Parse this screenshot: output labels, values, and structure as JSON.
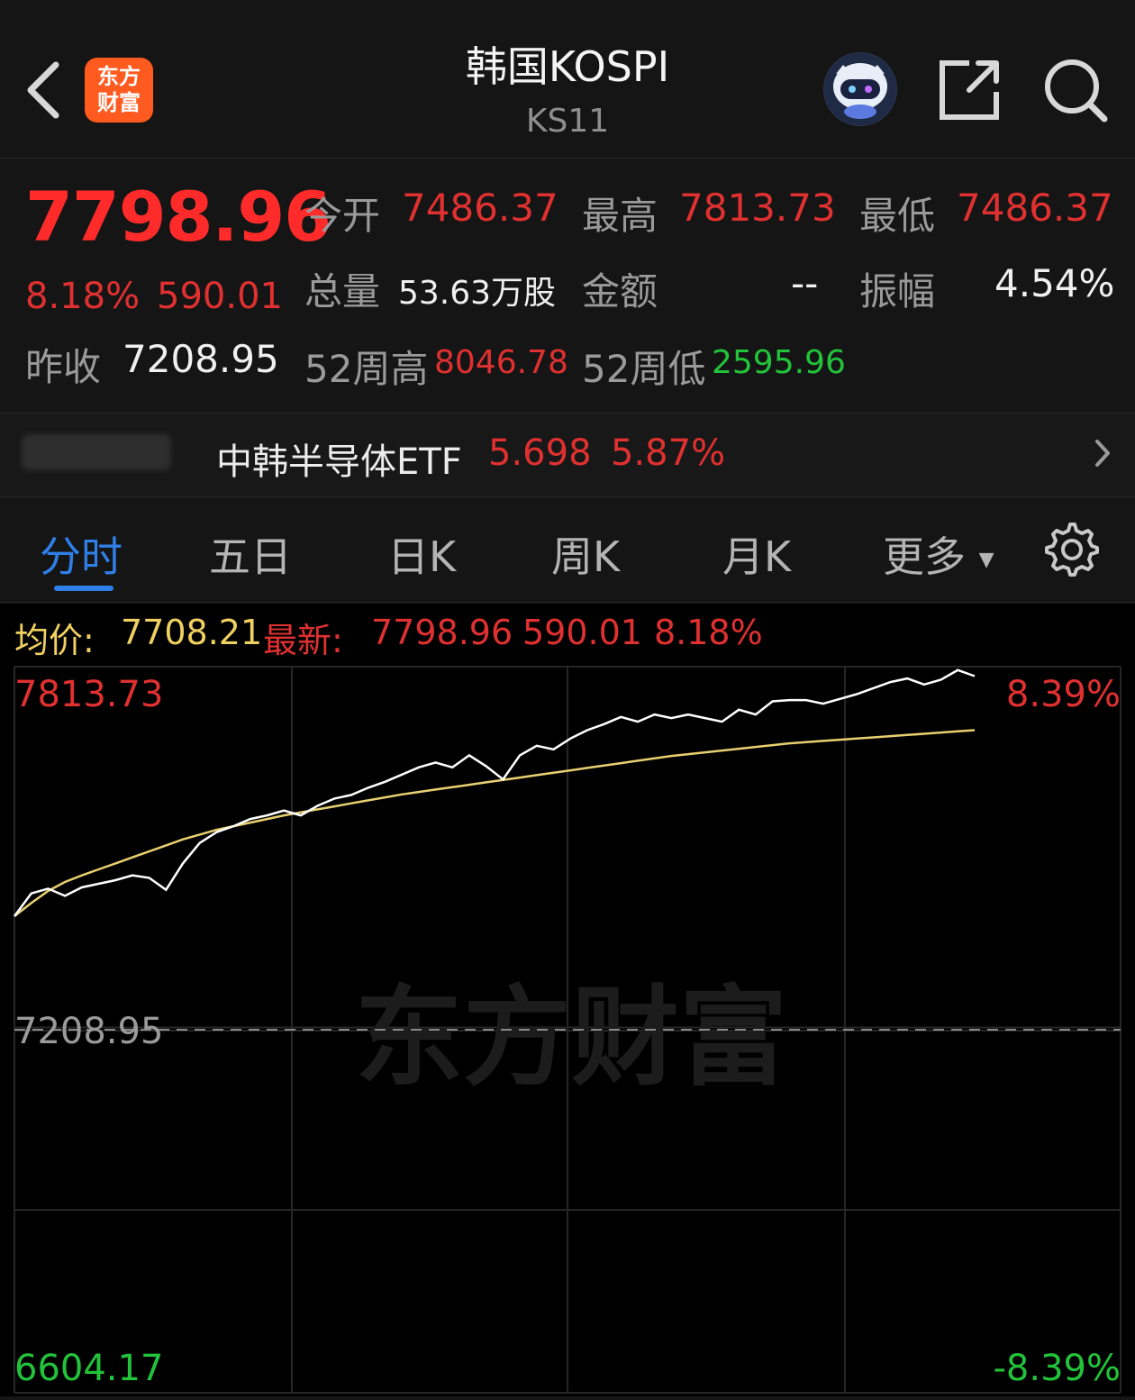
{
  "header": {
    "title": "韩国KOSPI",
    "subtitle": "KS11",
    "logo_line1": "东方",
    "logo_line2": "财富"
  },
  "quote": {
    "price": "7798.96",
    "change_pct": "8.18%",
    "change_amt": "590.01",
    "prev_close_label": "昨收",
    "prev_close": "7208.95",
    "open_label": "今开",
    "open": "7486.37",
    "high_label": "最高",
    "high": "7813.73",
    "low_label": "最低",
    "low": "7486.37",
    "volume_label": "总量",
    "volume": "53.63万股",
    "amount_label": "金额",
    "amount": "--",
    "amplitude_label": "振幅",
    "amplitude": "4.54%",
    "wk52_high_label": "52周高",
    "wk52_high": "8046.78",
    "wk52_low_label": "52周低",
    "wk52_low": "2595.96"
  },
  "etf": {
    "name": "中韩半导体ETF",
    "price": "5.698",
    "change": "5.87%"
  },
  "tabs": [
    "分时",
    "五日",
    "日K",
    "周K",
    "月K",
    "更多"
  ],
  "infobar": {
    "avg_label": "均价:",
    "avg_value": "7708.21",
    "latest_label": "最新:",
    "latest_value": "7798.96",
    "latest_change": "590.01",
    "latest_pct": "8.18%"
  },
  "watermark": "东方财富",
  "colors": {
    "up": "#e03030",
    "down": "#22c33a",
    "price_line": "#ffffff",
    "avg_line": "#e8d070",
    "active_tab": "#2f7fe8"
  },
  "chart_data": {
    "type": "line",
    "y_axis_left": [
      "7813.73",
      "7208.95",
      "6604.17"
    ],
    "y_axis_right": [
      "8.39%",
      "-8.39%"
    ],
    "ylim": [
      6604.17,
      7813.73
    ],
    "baseline": 7208.95,
    "series": [
      {
        "key": "price",
        "values": [
          7398,
          7436,
          7444,
          7432,
          7446,
          7452,
          7458,
          7466,
          7462,
          7442,
          7486,
          7520,
          7538,
          7548,
          7560,
          7566,
          7574,
          7566,
          7582,
          7594,
          7600,
          7612,
          7622,
          7634,
          7646,
          7654,
          7646,
          7666,
          7648,
          7626,
          7666,
          7682,
          7676,
          7694,
          7708,
          7718,
          7730,
          7722,
          7734,
          7728,
          7734,
          7728,
          7722,
          7742,
          7734,
          7756,
          7758,
          7758,
          7752,
          7760,
          7768,
          7778,
          7788,
          7794,
          7784,
          7792,
          7808,
          7798
        ]
      },
      {
        "key": "avg",
        "values": [
          7398,
          7420,
          7440,
          7455,
          7466,
          7476,
          7486,
          7496,
          7506,
          7516,
          7526,
          7534,
          7542,
          7548,
          7554,
          7560,
          7566,
          7571,
          7576,
          7581,
          7586,
          7591,
          7596,
          7601,
          7605,
          7609,
          7613,
          7617,
          7621,
          7625,
          7629,
          7633,
          7637,
          7641,
          7645,
          7649,
          7653,
          7657,
          7661,
          7665,
          7668,
          7671,
          7674,
          7677,
          7680,
          7683,
          7686,
          7688,
          7690,
          7692,
          7694,
          7696,
          7698,
          7700,
          7702,
          7704,
          7706,
          7708
        ]
      }
    ]
  }
}
